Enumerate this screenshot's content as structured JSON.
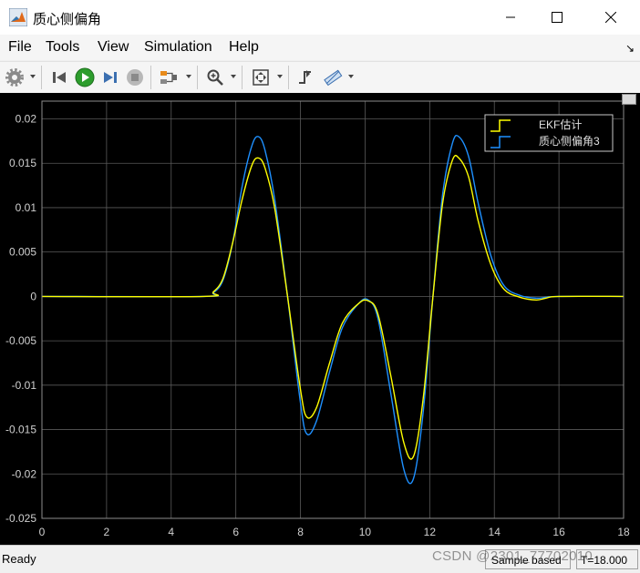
{
  "window": {
    "title": "质心侧偏角",
    "menu": [
      "File",
      "Tools",
      "View",
      "Simulation",
      "Help"
    ],
    "undock_glyph": "↘"
  },
  "toolbar": {
    "buttons": [
      "gear-icon",
      "step-back-icon",
      "run-icon",
      "step-forward-icon",
      "stop-icon",
      "highlight-icon",
      "zoom-icon",
      "fit-icon",
      "cursor-measure-icon",
      "triggers-icon"
    ]
  },
  "status": {
    "ready": "Ready",
    "sample": "Sample based",
    "time": "T=18.000",
    "watermark": "CSDN @2301_77702010"
  },
  "colors": {
    "series1": "#ffff00",
    "series2": "#1e90ff",
    "background": "#000000",
    "grid": "#5a5a5a",
    "axis_text": "#d0d0d0"
  },
  "chart_data": {
    "type": "line",
    "xlim": [
      0,
      18
    ],
    "ylim": [
      -0.025,
      0.022
    ],
    "xticks": [
      "0",
      "2",
      "4",
      "6",
      "8",
      "10",
      "12",
      "14",
      "16",
      "18"
    ],
    "yticks": [
      "0.02",
      "0.015",
      "0.01",
      "0.005",
      "0",
      "-0.005",
      "-0.01",
      "-0.015",
      "-0.02",
      "-0.025"
    ],
    "grid": true,
    "legend_position": "top-right",
    "series": [
      {
        "name": "EKF估计",
        "x": [
          0,
          5.0,
          5.3,
          5.6,
          5.9,
          6.2,
          6.5,
          6.7,
          6.9,
          7.2,
          7.6,
          8.0,
          8.2,
          8.5,
          8.9,
          9.3,
          9.8,
          10.1,
          10.4,
          10.8,
          11.2,
          11.5,
          11.8,
          12.1,
          12.4,
          12.7,
          12.9,
          13.2,
          13.5,
          13.9,
          14.3,
          14.8,
          15.3,
          15.6,
          16.0,
          18
        ],
        "y": [
          0,
          0.0,
          0.0005,
          0.002,
          0.006,
          0.011,
          0.0148,
          0.0156,
          0.0145,
          0.01,
          0.0,
          -0.0105,
          -0.0136,
          -0.0125,
          -0.0075,
          -0.003,
          -0.0008,
          -0.0005,
          -0.002,
          -0.009,
          -0.0165,
          -0.018,
          -0.0115,
          0.0,
          0.0105,
          0.0153,
          0.0156,
          0.0135,
          0.0085,
          0.0035,
          0.0008,
          -0.0001,
          -0.0004,
          -0.0002,
          0.0,
          0
        ]
      },
      {
        "name": "质心侧偏角3",
        "x": [
          0,
          5.0,
          5.3,
          5.6,
          5.9,
          6.2,
          6.5,
          6.7,
          6.9,
          7.2,
          7.6,
          8.0,
          8.2,
          8.5,
          8.9,
          9.3,
          9.8,
          10.1,
          10.4,
          10.8,
          11.2,
          11.5,
          11.8,
          12.1,
          12.4,
          12.7,
          12.9,
          13.2,
          13.5,
          13.9,
          14.3,
          14.8,
          15.3,
          15.6,
          16.0,
          18
        ],
        "y": [
          0,
          0.0,
          0.0004,
          0.0018,
          0.006,
          0.0125,
          0.017,
          0.018,
          0.0165,
          0.011,
          0.0,
          -0.012,
          -0.0155,
          -0.014,
          -0.0085,
          -0.0035,
          -0.0008,
          -0.0004,
          -0.0025,
          -0.011,
          -0.0195,
          -0.0205,
          -0.013,
          0.0,
          0.0115,
          0.0172,
          0.018,
          0.0158,
          0.0105,
          0.0045,
          0.0012,
          0.0001,
          -0.0002,
          -0.0001,
          0.0,
          0
        ]
      }
    ]
  }
}
